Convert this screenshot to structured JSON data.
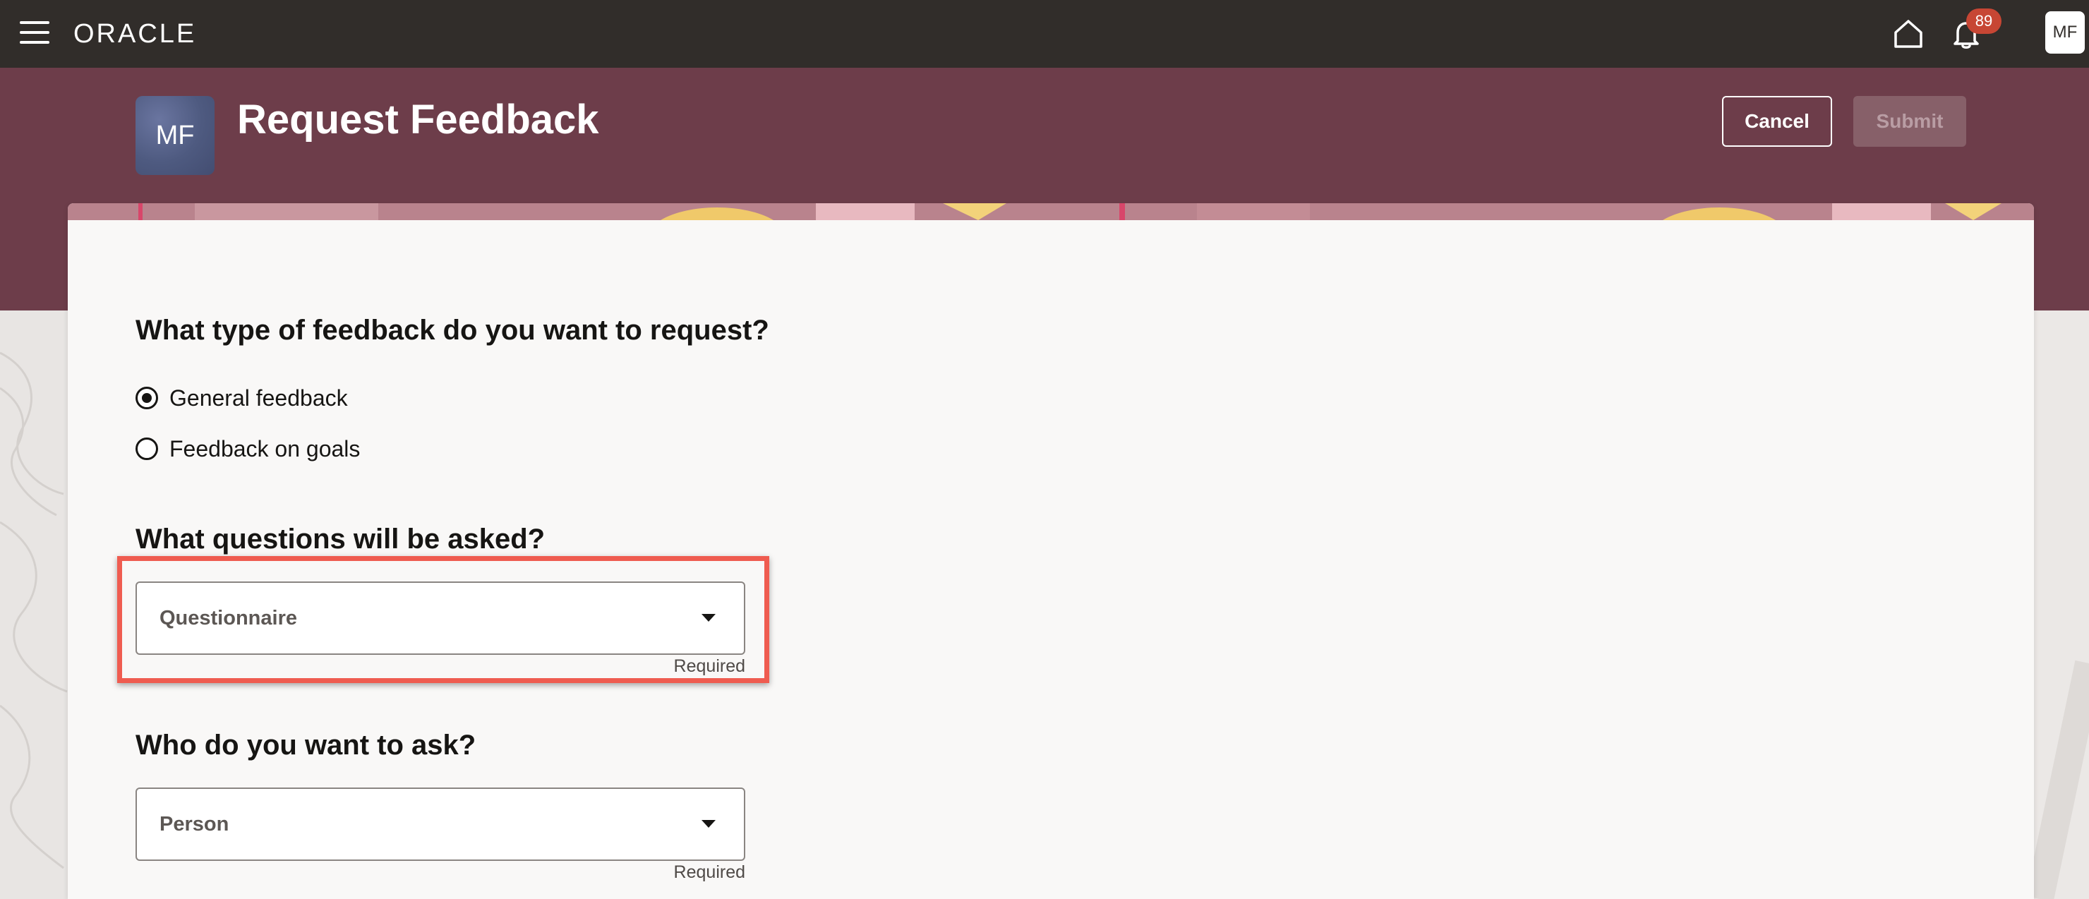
{
  "topbar": {
    "logo_text": "ORACLE",
    "notification_count": "89",
    "user_initials": "MF",
    "icons": {
      "menu": "hamburger-menu-icon",
      "home": "home-icon",
      "notifications": "bell-icon"
    }
  },
  "header": {
    "avatar_initials": "MF",
    "title": "Request Feedback",
    "cancel_label": "Cancel",
    "submit_label": "Submit",
    "submit_enabled": false
  },
  "form": {
    "feedback_type": {
      "heading": "What type of feedback do you want to request?",
      "options": [
        {
          "label": "General feedback",
          "selected": true
        },
        {
          "label": "Feedback on goals",
          "selected": false
        }
      ]
    },
    "questions": {
      "heading": "What questions will be asked?",
      "select_placeholder": "Questionnaire",
      "helper": "Required"
    },
    "recipients": {
      "heading": "Who do you want to ask?",
      "select_placeholder": "Person",
      "helper": "Required"
    }
  },
  "colors": {
    "topbar_bg": "#312d2a",
    "header_bg": "#6d3d4a",
    "badge_bg": "#c74634",
    "highlight_border": "#ef5c50",
    "card_bg": "#f9f8f7"
  }
}
